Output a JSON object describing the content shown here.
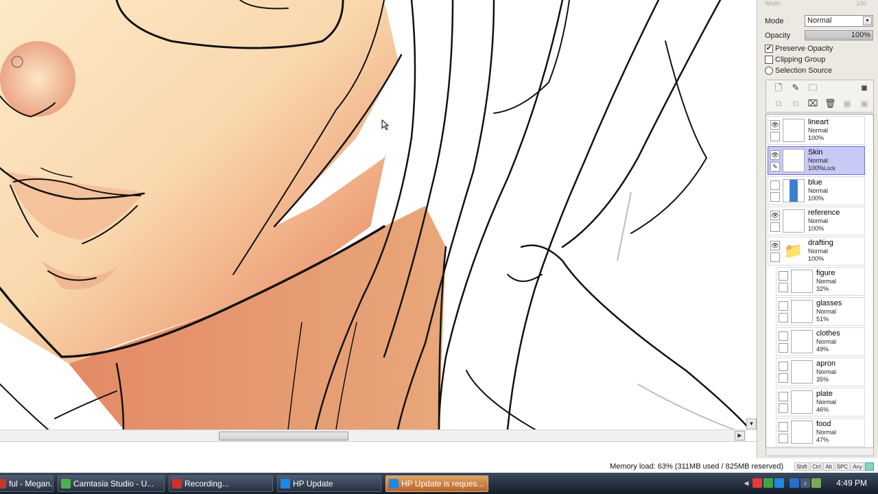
{
  "canvas": {
    "colors": {
      "skin_light": "#fde9c7",
      "skin_mid": "#f2b58f",
      "skin_shadow": "#d9714e",
      "lineart": "#111111"
    }
  },
  "properties": {
    "width_label": "Width",
    "width_value": "100",
    "mode_label": "Mode",
    "mode_value": "Normal",
    "opacity_label": "Opacity",
    "opacity_value": "100%",
    "preserve_opacity": "Preserve Opacity",
    "clipping_group": "Clipping Group",
    "selection_source": "Selection Source"
  },
  "layers": [
    {
      "name": "lineart",
      "mode": "Normal",
      "opacity": "100%",
      "visible": true,
      "selected": false,
      "child": false,
      "thumb": "plain"
    },
    {
      "name": "Skin",
      "mode": "Normal",
      "opacity": "100%",
      "lock_text": "Lock",
      "visible": true,
      "selected": true,
      "child": false,
      "thumb": "plain"
    },
    {
      "name": "blue",
      "mode": "Normal",
      "opacity": "100%",
      "visible": false,
      "selected": false,
      "child": false,
      "thumb": "blue"
    },
    {
      "name": "reference",
      "mode": "Normal",
      "opacity": "100%",
      "visible": true,
      "selected": false,
      "child": false,
      "thumb": "plain"
    },
    {
      "name": "drafting",
      "mode": "Normal",
      "opacity": "100%",
      "visible": true,
      "selected": false,
      "child": false,
      "thumb": "folder"
    },
    {
      "name": "figure",
      "mode": "Normal",
      "opacity": "32%",
      "visible": false,
      "selected": false,
      "child": true,
      "thumb": "plain"
    },
    {
      "name": "glasses",
      "mode": "Normal",
      "opacity": "51%",
      "visible": false,
      "selected": false,
      "child": true,
      "thumb": "plain"
    },
    {
      "name": "clothes",
      "mode": "Normal",
      "opacity": "49%",
      "visible": false,
      "selected": false,
      "child": true,
      "thumb": "plain"
    },
    {
      "name": "apron",
      "mode": "Normal",
      "opacity": "35%",
      "visible": false,
      "selected": false,
      "child": true,
      "thumb": "plain"
    },
    {
      "name": "plate",
      "mode": "Normal",
      "opacity": "46%",
      "visible": false,
      "selected": false,
      "child": true,
      "thumb": "plain"
    },
    {
      "name": "food",
      "mode": "Normal",
      "opacity": "47%",
      "visible": false,
      "selected": false,
      "child": true,
      "thumb": "plain"
    }
  ],
  "status": {
    "memory_load": "Memory load: 63% (311MB used / 825MB reserved)",
    "keys": [
      "Shift",
      "Ctrl",
      "Alt",
      "SPC",
      "Any"
    ]
  },
  "taskbar": {
    "tasks": [
      {
        "label": "ful - Megan...",
        "icon": "paint-icon",
        "color": "#c0392b"
      },
      {
        "label": "Camtasia Studio - U...",
        "icon": "camtasia-icon",
        "color": "#4caf50"
      },
      {
        "label": "Recording...",
        "icon": "record-icon",
        "color": "#d32f2f"
      },
      {
        "label": "HP Update",
        "icon": "hp-icon",
        "color": "#1e88e5"
      },
      {
        "label": "HP Update is reques...",
        "icon": "hp-request-icon",
        "color": "#1e88e5"
      }
    ],
    "clock": "4:49 PM"
  }
}
